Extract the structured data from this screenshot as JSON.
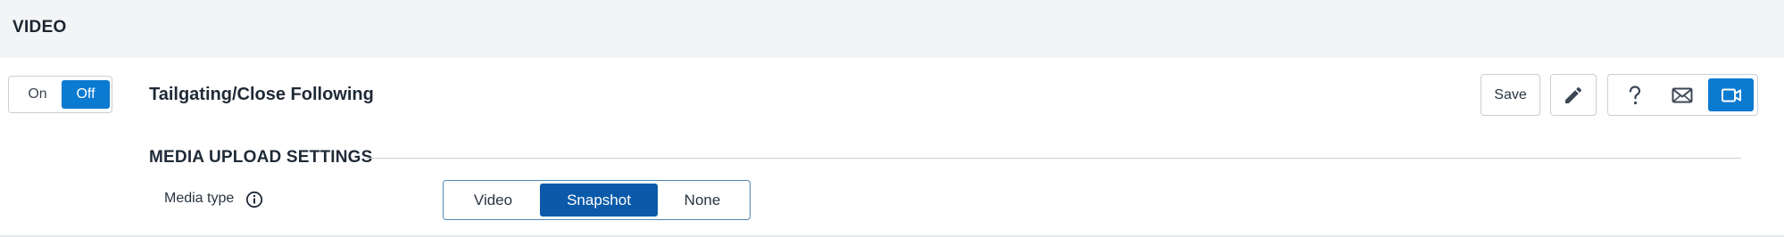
{
  "section": {
    "title": "VIDEO"
  },
  "toggle": {
    "on_label": "On",
    "off_label": "Off",
    "selected": "Off"
  },
  "rule": {
    "title": "Tailgating/Close Following"
  },
  "actions": {
    "save_label": "Save",
    "edit_icon": "pencil-icon",
    "help_icon": "question-icon",
    "mail_icon": "envelope-icon",
    "video_icon": "video-camera-icon"
  },
  "media_upload": {
    "title": "MEDIA UPLOAD SETTINGS",
    "media_type_label": "Media type",
    "info_icon": "info-icon",
    "options": [
      "Video",
      "Snapshot",
      "None"
    ],
    "selected": "Snapshot"
  },
  "colors": {
    "accent": "#0b7ad1",
    "selected_segment": "#0a5aa9",
    "header_bg": "#f3f4f6"
  }
}
